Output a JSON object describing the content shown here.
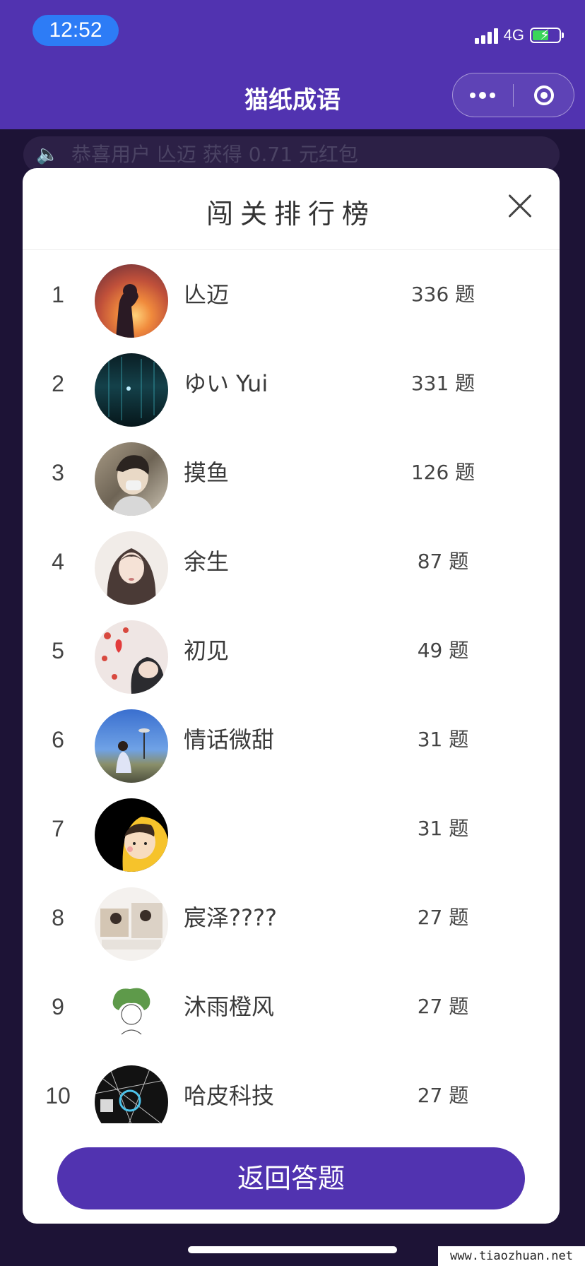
{
  "status_bar": {
    "time": "12:52",
    "network": "4G"
  },
  "nav": {
    "title": "猫纸成语"
  },
  "marquee": {
    "text": "恭喜用户 亾迈 获得 0.71 元红包"
  },
  "modal": {
    "title": "闯关排行榜"
  },
  "leaderboard": [
    {
      "rank": "1",
      "name": "亾迈",
      "score": "336 题"
    },
    {
      "rank": "2",
      "name": "ゆい Yui",
      "score": "331 题"
    },
    {
      "rank": "3",
      "name": "摸鱼",
      "score": "126 题"
    },
    {
      "rank": "4",
      "name": "余生",
      "score": "87 题"
    },
    {
      "rank": "5",
      "name": "初见",
      "score": "49 题"
    },
    {
      "rank": "6",
      "name": "情话微甜",
      "score": "31 题"
    },
    {
      "rank": "7",
      "name": "",
      "score": "31 题"
    },
    {
      "rank": "8",
      "name": "宸泽????",
      "score": "27 题"
    },
    {
      "rank": "9",
      "name": "沐雨橙风",
      "score": "27 题"
    },
    {
      "rank": "10",
      "name": "哈皮科技",
      "score": "27 题"
    }
  ],
  "buttons": {
    "return": "返回答题"
  },
  "watermark": "www.tiaozhuan.net",
  "colors": {
    "brand": "#5133b0",
    "time_pill": "#2d7cf6",
    "backdrop": "#1d1336"
  }
}
